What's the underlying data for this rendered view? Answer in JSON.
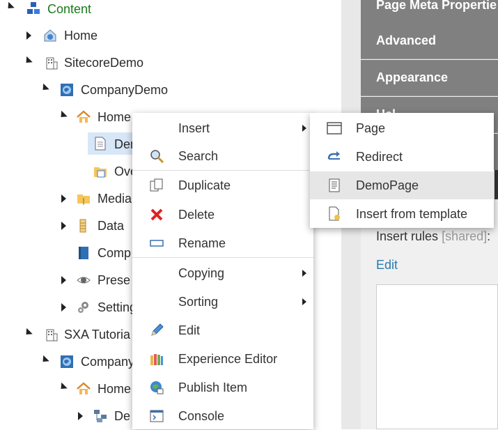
{
  "tree": {
    "content": "Content",
    "home_root": "Home",
    "sitecoredemo": "SitecoreDemo",
    "companydemo": "CompanyDemo",
    "home": "Home",
    "demo_partial": "Dem",
    "ove_partial": "Ove",
    "media_partial": "Media",
    "data": "Data",
    "comp_partial": "Comp",
    "prese_partial": "Prese",
    "setting_partial": "Setting",
    "sxa_partial": "SXA Tutoria",
    "company_partial": "Company",
    "home2": "Home",
    "de_partial": "De"
  },
  "right_panel": {
    "sections": [
      "Page Meta Propertie",
      "Advanced",
      "Appearance",
      "Hel"
    ],
    "insert_rules_label": "Insert rules",
    "shared_tag": "[shared]",
    "colon": ":",
    "edit_link": "Edit"
  },
  "context_menu": {
    "insert": "Insert",
    "search": "Search",
    "duplicate": "Duplicate",
    "delete": "Delete",
    "rename": "Rename",
    "copying": "Copying",
    "sorting": "Sorting",
    "edit": "Edit",
    "experience_editor": "Experience Editor",
    "publish_item": "Publish Item",
    "console": "Console"
  },
  "submenu": {
    "page": "Page",
    "redirect": "Redirect",
    "demopage": "DemoPage",
    "insert_from_template": "Insert from template"
  },
  "colors": {
    "content_green": "#1a7a1a",
    "section_gray": "#808080",
    "link_blue": "#2a7ab0",
    "hover_gray": "#e6e6e6",
    "selected_blue": "#d8e7f7"
  }
}
